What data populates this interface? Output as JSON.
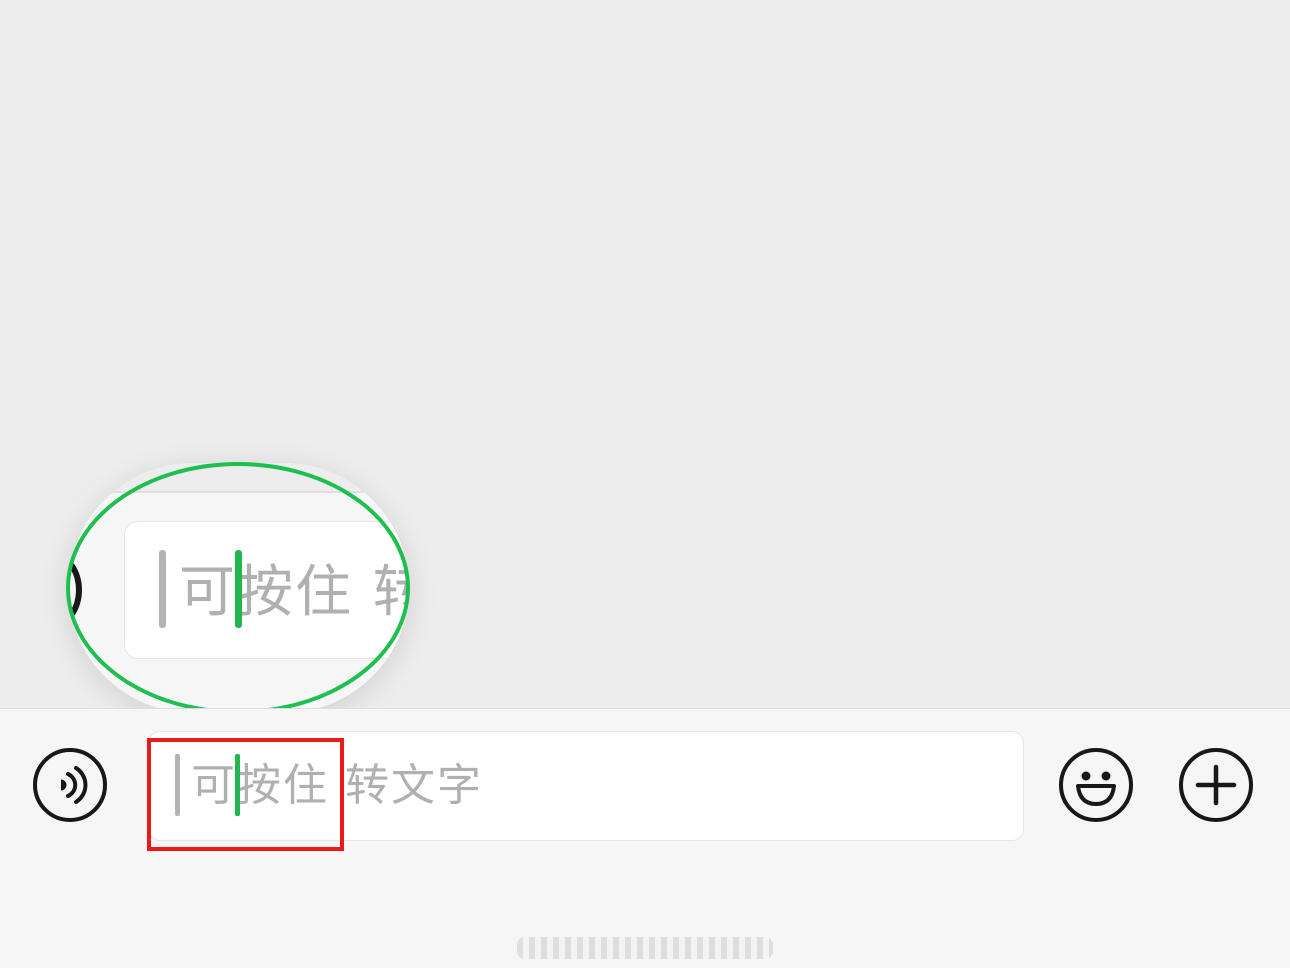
{
  "input_bar": {
    "voice_icon": "voice-mode-icon",
    "placeholder": "可按住 转文字",
    "emoji_icon": "smiley-face-icon",
    "plus_icon": "plus-icon"
  },
  "magnifier": {
    "text": "可按住 转"
  },
  "annotations": {
    "red_highlight_color": "#ea1a1a",
    "green_circle_color": "#1fbf4f"
  },
  "colors": {
    "placeholder_text": "#b0b0b0",
    "caret_selected": "#1fb84f",
    "caret_inactive": "#b3b3b3",
    "background": "#ededed"
  }
}
